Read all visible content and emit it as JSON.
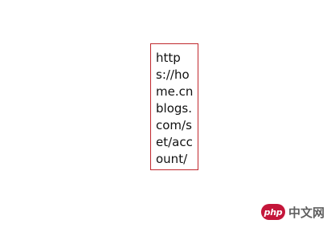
{
  "content": {
    "url_text": "https://home.cnblogs.com/set/account/"
  },
  "watermark": {
    "logo_text": "php",
    "site_text": "中文网"
  },
  "colors": {
    "box_border": "#c0282d",
    "logo_bg": "#c4163a"
  }
}
